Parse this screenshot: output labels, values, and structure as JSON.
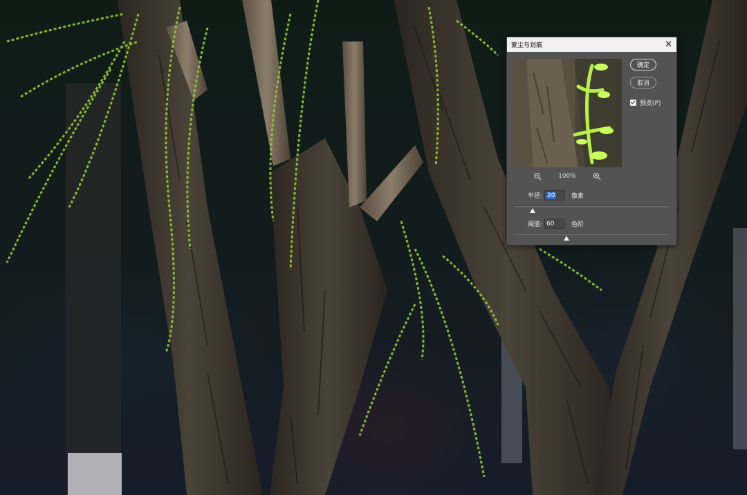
{
  "dialog": {
    "title": "蒙尘与划痕",
    "ok_label": "确定",
    "cancel_label": "取消",
    "preview_label": "预览(P)",
    "preview_checked": true,
    "zoom_level": "100%",
    "radius": {
      "label": "半径:",
      "value": "20",
      "unit": "像素",
      "slider_fraction": 0.12
    },
    "threshold": {
      "label": "阈值:",
      "value": "60",
      "unit": "色阶",
      "slider_fraction": 0.34
    }
  },
  "icons": {
    "zoom_out": "zoom-out-icon",
    "zoom_in": "zoom-in-icon",
    "close": "close-icon"
  },
  "colors": {
    "dialog_bg": "#535353",
    "titlebar_bg": "#f0f0f0",
    "foliage": "#9ad83a"
  }
}
